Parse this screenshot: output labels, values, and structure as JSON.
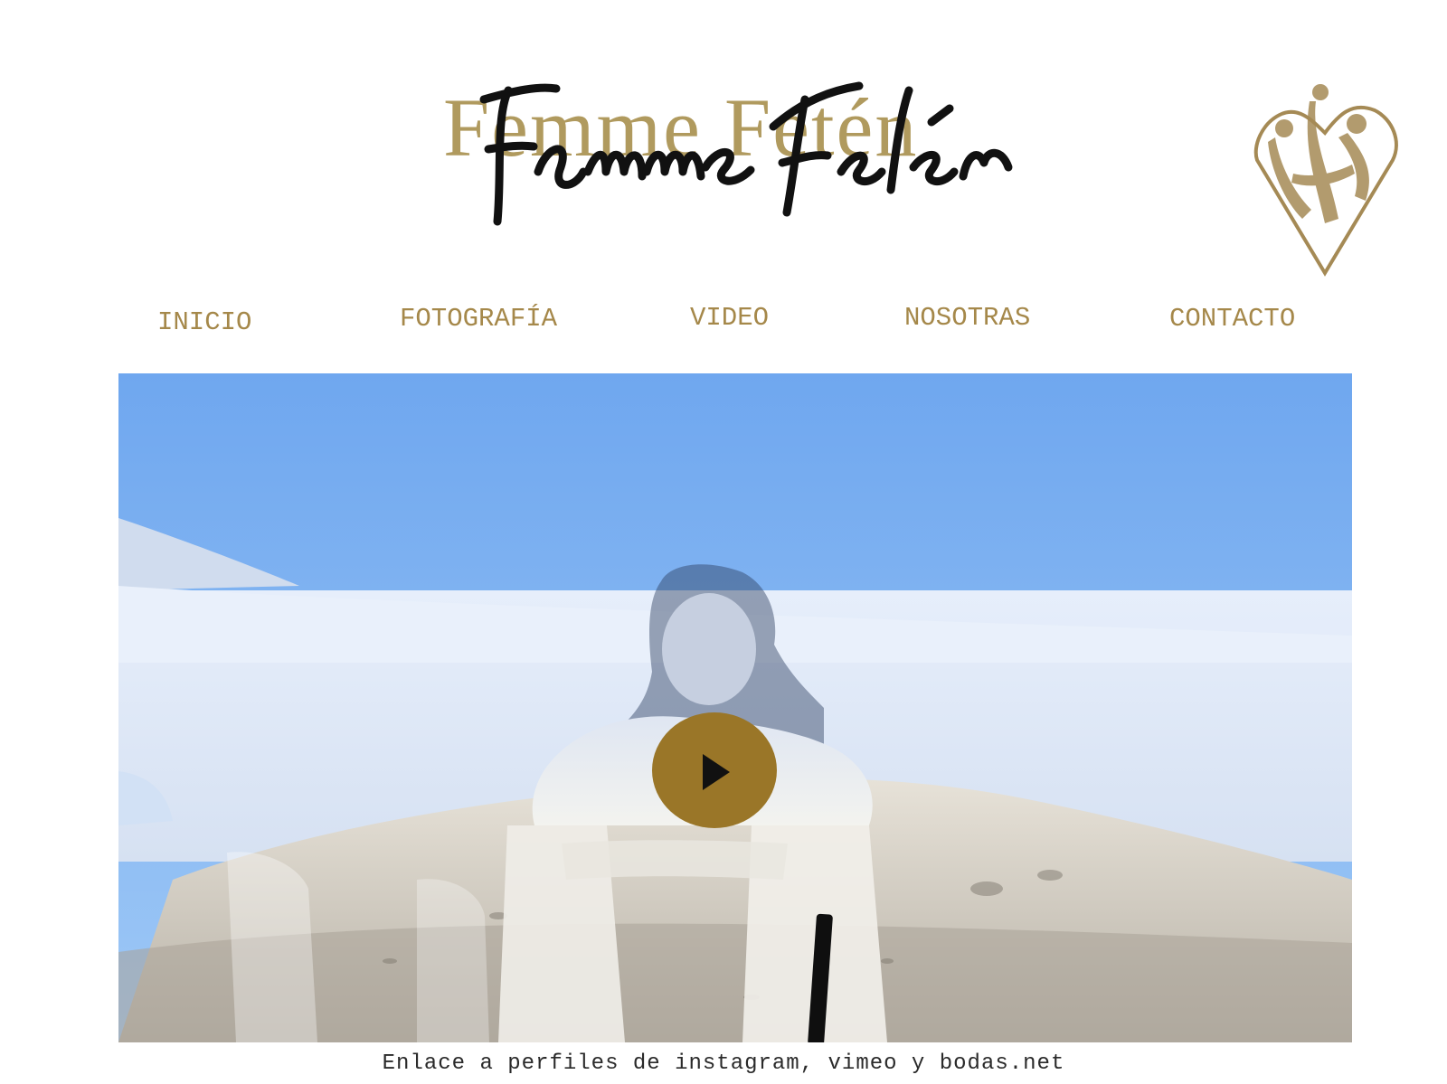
{
  "brand": {
    "logo_text": "Femme Fetén",
    "emblem_icon": "heart-emblem-illustration-icon"
  },
  "nav": {
    "items": [
      {
        "label": "INICIO"
      },
      {
        "label": "FOTOGRAFÍA"
      },
      {
        "label": "VIDEO"
      },
      {
        "label": "NOSOTRAS"
      },
      {
        "label": "CONTACTO"
      }
    ]
  },
  "hero": {
    "play_icon": "play-icon"
  },
  "footer": {
    "caption": "Enlace a perfiles de instagram, vimeo y bodas.net"
  },
  "colors": {
    "gold": "#a5884a",
    "play": "#9a7628",
    "sky": "#78aef0"
  }
}
